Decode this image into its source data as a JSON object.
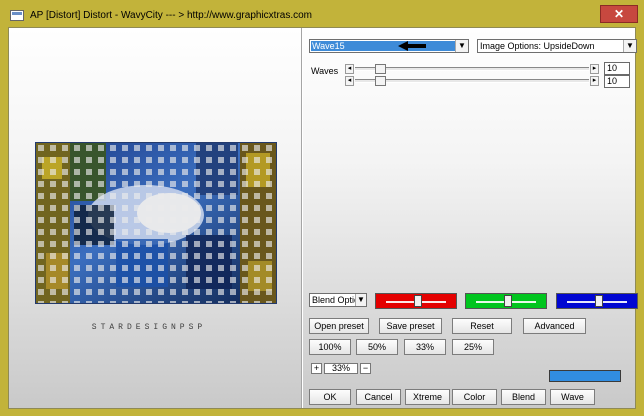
{
  "window": {
    "title": "AP [Distort]  Distort - WavyCity    --- > http://www.graphicxtras.com",
    "close_glyph": "✕"
  },
  "brand": {
    "text": "STARDESIGNPSP"
  },
  "controls": {
    "wave_preset": {
      "selected": "Wave15"
    },
    "image_options": {
      "selected": "Image Options: UpsideDown"
    },
    "waves": {
      "label": "Waves",
      "step_left": "◂",
      "step_right": "▸",
      "slider1_value": "10",
      "slider2_value": "10",
      "slider1_fraction": 0.1,
      "slider2_fraction": 0.1
    },
    "blend_options": {
      "selected": "Blend Optio"
    },
    "colors": {
      "red": "#e40000",
      "green": "#00c51e",
      "blue": "#0006d2",
      "swatch": "#318de1"
    },
    "buttons": {
      "open_preset": "Open preset",
      "save_preset": "Save preset",
      "reset": "Reset",
      "advanced": "Advanced",
      "zoom_100": "100%",
      "zoom_50": "50%",
      "zoom_33": "33%",
      "zoom_25": "25%",
      "ok": "OK",
      "cancel": "Cancel",
      "xtreme": "Xtreme",
      "color": "Color",
      "blend": "Blend",
      "wave": "Wave"
    },
    "zoom": {
      "plus": "+",
      "value": "33%",
      "minus": "−"
    }
  }
}
